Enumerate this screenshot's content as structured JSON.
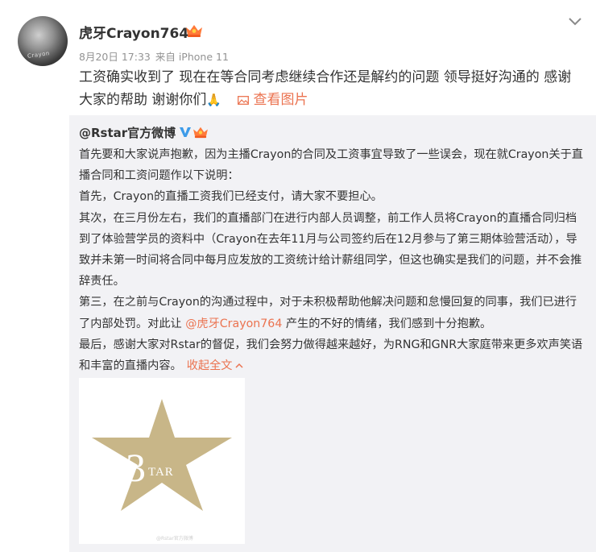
{
  "post": {
    "username": "虎牙Crayon764",
    "date": "8月20日 17:33",
    "source": "来自 iPhone 11",
    "text": "工资确实收到了 现在在等合同考虑继续合作还是解约的问题 领导挺好沟通的 感谢大家的帮助 谢谢你们",
    "emoji": "🙏",
    "view_pic_label": "查看图片"
  },
  "repost": {
    "author": "@Rstar官方微博",
    "paragraphs": [
      "首先要和大家说声抱歉，因为主播Crayon的合同及工资事宜导致了一些误会，现在就Crayon关于直播合同和工资问题作以下说明：",
      "首先，Crayon的直播工资我们已经支付，请大家不要担心。",
      "其次，在三月份左右，我们的直播部门在进行内部人员调整，前工作人员将Crayon的直播合同归档到了体验营学员的资料中（Crayon在去年11月与公司签约后在12月参与了第三期体验营活动），导致并未第一时间将合同中每月应发放的工资统计给计薪组同学，但这也确实是我们的问题，并不会推辞责任。"
    ],
    "p4_before": "第三，在之前与Crayon的沟通过程中，对于未积极帮助他解决问题和怠慢回复的同事，我们已进行了内部处罚。对此让 ",
    "p4_mention": "@虎牙Crayon764",
    "p4_after": " 产生的不好的情绪，我们感到十分抱歉。",
    "p5": "最后，感谢大家对Rstar的督促，我们会努力做得越来越好，为RNG和GNR大家庭带来更多欢声笑语和丰富的直播内容。",
    "collapse_label": "收起全文"
  },
  "image": {
    "logo_text": "TAR",
    "logo_number": "3",
    "watermark": "@Rstar官方微博",
    "star_color": "#c8b688",
    "avatar_text": "Crayon"
  },
  "colors": {
    "accent": "#eb7350",
    "repost_bg": "#f2f2f5",
    "meta": "#939393"
  }
}
